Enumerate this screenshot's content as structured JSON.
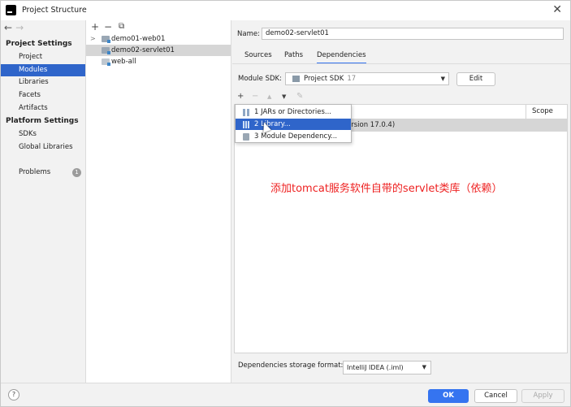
{
  "window": {
    "title": "Project Structure",
    "close_glyph": "✕"
  },
  "sidebar": {
    "nav_back": "←",
    "nav_forward": "→",
    "project_settings_heading": "Project Settings",
    "project_items": [
      {
        "label": "Project",
        "selected": false
      },
      {
        "label": "Modules",
        "selected": true
      },
      {
        "label": "Libraries",
        "selected": false
      },
      {
        "label": "Facets",
        "selected": false
      },
      {
        "label": "Artifacts",
        "selected": false
      }
    ],
    "platform_settings_heading": "Platform Settings",
    "platform_items": [
      {
        "label": "SDKs"
      },
      {
        "label": "Global Libraries"
      }
    ],
    "problems_label": "Problems",
    "problems_count": "1"
  },
  "tree": {
    "toolbar": {
      "add": "+",
      "remove": "−",
      "copy": "⧉"
    },
    "modules": [
      {
        "label": "demo01-web01",
        "expandable": true,
        "selected": false
      },
      {
        "label": "demo02-servlet01",
        "expandable": false,
        "selected": true
      },
      {
        "label": "web-all",
        "expandable": false,
        "selected": false
      }
    ]
  },
  "module": {
    "name_label": "Name:",
    "name_value": "demo02-servlet01",
    "tabs": [
      {
        "label": "Sources",
        "active": false
      },
      {
        "label": "Paths",
        "active": false
      },
      {
        "label": "Dependencies",
        "active": true
      }
    ],
    "sdk_label": "Module SDK:",
    "sdk_value": "Project SDK",
    "sdk_version": "17",
    "edit_button": "Edit",
    "dep_toolbar": {
      "add": "+",
      "remove": "−",
      "up": "▲",
      "down": "▼",
      "edit": "✎"
    },
    "scope_header": "Scope",
    "dep_row_text": "ersion 17.0.4)",
    "annotation": "添加tomcat服务软件自带的servlet类库（依赖）",
    "storage_label": "Dependencies storage format:",
    "storage_value": "IntelliJ IDEA (.iml)"
  },
  "popup_menu": {
    "items": [
      {
        "label": "1  JARs or Directories...",
        "highlighted": false,
        "icon": "jar-icon"
      },
      {
        "label": "2  Library...",
        "highlighted": true,
        "icon": "library-icon"
      },
      {
        "label": "3  Module Dependency...",
        "highlighted": false,
        "icon": "module-icon"
      }
    ]
  },
  "footer": {
    "help": "?",
    "ok": "OK",
    "cancel": "Cancel",
    "apply": "Apply"
  },
  "colors": {
    "accent": "#3574f0",
    "selection": "#2f65ca",
    "annotation": "#ee2222"
  }
}
